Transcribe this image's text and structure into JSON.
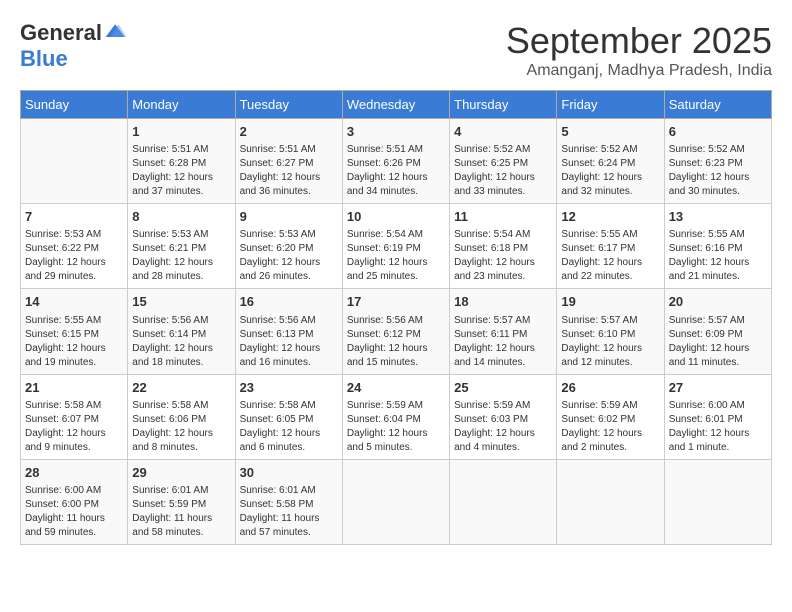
{
  "logo": {
    "general": "General",
    "blue": "Blue"
  },
  "title": "September 2025",
  "subtitle": "Amanganj, Madhya Pradesh, India",
  "headers": [
    "Sunday",
    "Monday",
    "Tuesday",
    "Wednesday",
    "Thursday",
    "Friday",
    "Saturday"
  ],
  "weeks": [
    [
      {
        "day": "",
        "info": ""
      },
      {
        "day": "1",
        "info": "Sunrise: 5:51 AM\nSunset: 6:28 PM\nDaylight: 12 hours\nand 37 minutes."
      },
      {
        "day": "2",
        "info": "Sunrise: 5:51 AM\nSunset: 6:27 PM\nDaylight: 12 hours\nand 36 minutes."
      },
      {
        "day": "3",
        "info": "Sunrise: 5:51 AM\nSunset: 6:26 PM\nDaylight: 12 hours\nand 34 minutes."
      },
      {
        "day": "4",
        "info": "Sunrise: 5:52 AM\nSunset: 6:25 PM\nDaylight: 12 hours\nand 33 minutes."
      },
      {
        "day": "5",
        "info": "Sunrise: 5:52 AM\nSunset: 6:24 PM\nDaylight: 12 hours\nand 32 minutes."
      },
      {
        "day": "6",
        "info": "Sunrise: 5:52 AM\nSunset: 6:23 PM\nDaylight: 12 hours\nand 30 minutes."
      }
    ],
    [
      {
        "day": "7",
        "info": "Sunrise: 5:53 AM\nSunset: 6:22 PM\nDaylight: 12 hours\nand 29 minutes."
      },
      {
        "day": "8",
        "info": "Sunrise: 5:53 AM\nSunset: 6:21 PM\nDaylight: 12 hours\nand 28 minutes."
      },
      {
        "day": "9",
        "info": "Sunrise: 5:53 AM\nSunset: 6:20 PM\nDaylight: 12 hours\nand 26 minutes."
      },
      {
        "day": "10",
        "info": "Sunrise: 5:54 AM\nSunset: 6:19 PM\nDaylight: 12 hours\nand 25 minutes."
      },
      {
        "day": "11",
        "info": "Sunrise: 5:54 AM\nSunset: 6:18 PM\nDaylight: 12 hours\nand 23 minutes."
      },
      {
        "day": "12",
        "info": "Sunrise: 5:55 AM\nSunset: 6:17 PM\nDaylight: 12 hours\nand 22 minutes."
      },
      {
        "day": "13",
        "info": "Sunrise: 5:55 AM\nSunset: 6:16 PM\nDaylight: 12 hours\nand 21 minutes."
      }
    ],
    [
      {
        "day": "14",
        "info": "Sunrise: 5:55 AM\nSunset: 6:15 PM\nDaylight: 12 hours\nand 19 minutes."
      },
      {
        "day": "15",
        "info": "Sunrise: 5:56 AM\nSunset: 6:14 PM\nDaylight: 12 hours\nand 18 minutes."
      },
      {
        "day": "16",
        "info": "Sunrise: 5:56 AM\nSunset: 6:13 PM\nDaylight: 12 hours\nand 16 minutes."
      },
      {
        "day": "17",
        "info": "Sunrise: 5:56 AM\nSunset: 6:12 PM\nDaylight: 12 hours\nand 15 minutes."
      },
      {
        "day": "18",
        "info": "Sunrise: 5:57 AM\nSunset: 6:11 PM\nDaylight: 12 hours\nand 14 minutes."
      },
      {
        "day": "19",
        "info": "Sunrise: 5:57 AM\nSunset: 6:10 PM\nDaylight: 12 hours\nand 12 minutes."
      },
      {
        "day": "20",
        "info": "Sunrise: 5:57 AM\nSunset: 6:09 PM\nDaylight: 12 hours\nand 11 minutes."
      }
    ],
    [
      {
        "day": "21",
        "info": "Sunrise: 5:58 AM\nSunset: 6:07 PM\nDaylight: 12 hours\nand 9 minutes."
      },
      {
        "day": "22",
        "info": "Sunrise: 5:58 AM\nSunset: 6:06 PM\nDaylight: 12 hours\nand 8 minutes."
      },
      {
        "day": "23",
        "info": "Sunrise: 5:58 AM\nSunset: 6:05 PM\nDaylight: 12 hours\nand 6 minutes."
      },
      {
        "day": "24",
        "info": "Sunrise: 5:59 AM\nSunset: 6:04 PM\nDaylight: 12 hours\nand 5 minutes."
      },
      {
        "day": "25",
        "info": "Sunrise: 5:59 AM\nSunset: 6:03 PM\nDaylight: 12 hours\nand 4 minutes."
      },
      {
        "day": "26",
        "info": "Sunrise: 5:59 AM\nSunset: 6:02 PM\nDaylight: 12 hours\nand 2 minutes."
      },
      {
        "day": "27",
        "info": "Sunrise: 6:00 AM\nSunset: 6:01 PM\nDaylight: 12 hours\nand 1 minute."
      }
    ],
    [
      {
        "day": "28",
        "info": "Sunrise: 6:00 AM\nSunset: 6:00 PM\nDaylight: 11 hours\nand 59 minutes."
      },
      {
        "day": "29",
        "info": "Sunrise: 6:01 AM\nSunset: 5:59 PM\nDaylight: 11 hours\nand 58 minutes."
      },
      {
        "day": "30",
        "info": "Sunrise: 6:01 AM\nSunset: 5:58 PM\nDaylight: 11 hours\nand 57 minutes."
      },
      {
        "day": "",
        "info": ""
      },
      {
        "day": "",
        "info": ""
      },
      {
        "day": "",
        "info": ""
      },
      {
        "day": "",
        "info": ""
      }
    ]
  ]
}
